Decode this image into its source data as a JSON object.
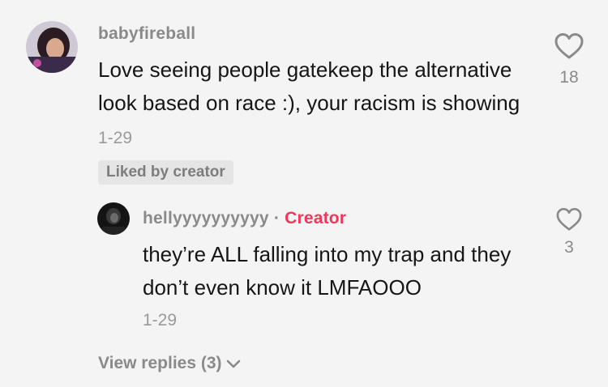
{
  "comment": {
    "username": "babyfireball",
    "text": "Love seeing people gatekeep the alternative look based on race :), your racism is showing",
    "timestamp": "1-29",
    "liked_badge": "Liked by creator",
    "like_count": "18"
  },
  "reply": {
    "username": "hellyyyyyyyyyy",
    "separator": "·",
    "creator_label": "Creator",
    "text": "they’re ALL falling into my trap and they don’t even know it LMFAOOO",
    "timestamp": "1-29",
    "like_count": "3"
  },
  "view_replies": {
    "label": "View replies (3)"
  },
  "colors": {
    "creator": "#f0395a",
    "background": "#f5f4f4",
    "text": "#161616",
    "muted": "#8a8a8a"
  },
  "icons": [
    "heart-icon",
    "chevron-down-icon"
  ]
}
